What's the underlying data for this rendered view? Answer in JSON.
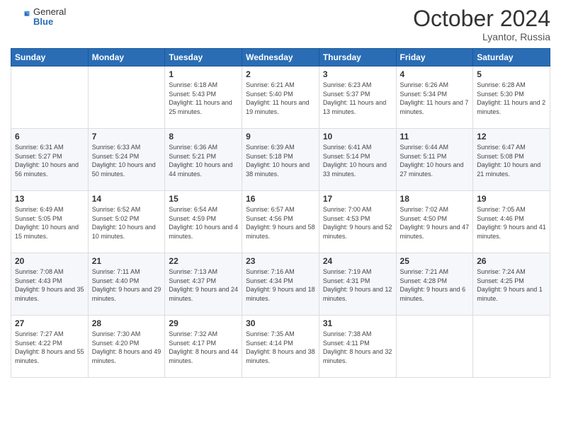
{
  "header": {
    "logo_general": "General",
    "logo_blue": "Blue",
    "month_title": "October 2024",
    "location": "Lyantor, Russia"
  },
  "weekdays": [
    "Sunday",
    "Monday",
    "Tuesday",
    "Wednesday",
    "Thursday",
    "Friday",
    "Saturday"
  ],
  "weeks": [
    [
      {
        "day": "",
        "info": ""
      },
      {
        "day": "",
        "info": ""
      },
      {
        "day": "1",
        "info": "Sunrise: 6:18 AM\nSunset: 5:43 PM\nDaylight: 11 hours and 25 minutes."
      },
      {
        "day": "2",
        "info": "Sunrise: 6:21 AM\nSunset: 5:40 PM\nDaylight: 11 hours and 19 minutes."
      },
      {
        "day": "3",
        "info": "Sunrise: 6:23 AM\nSunset: 5:37 PM\nDaylight: 11 hours and 13 minutes."
      },
      {
        "day": "4",
        "info": "Sunrise: 6:26 AM\nSunset: 5:34 PM\nDaylight: 11 hours and 7 minutes."
      },
      {
        "day": "5",
        "info": "Sunrise: 6:28 AM\nSunset: 5:30 PM\nDaylight: 11 hours and 2 minutes."
      }
    ],
    [
      {
        "day": "6",
        "info": "Sunrise: 6:31 AM\nSunset: 5:27 PM\nDaylight: 10 hours and 56 minutes."
      },
      {
        "day": "7",
        "info": "Sunrise: 6:33 AM\nSunset: 5:24 PM\nDaylight: 10 hours and 50 minutes."
      },
      {
        "day": "8",
        "info": "Sunrise: 6:36 AM\nSunset: 5:21 PM\nDaylight: 10 hours and 44 minutes."
      },
      {
        "day": "9",
        "info": "Sunrise: 6:39 AM\nSunset: 5:18 PM\nDaylight: 10 hours and 38 minutes."
      },
      {
        "day": "10",
        "info": "Sunrise: 6:41 AM\nSunset: 5:14 PM\nDaylight: 10 hours and 33 minutes."
      },
      {
        "day": "11",
        "info": "Sunrise: 6:44 AM\nSunset: 5:11 PM\nDaylight: 10 hours and 27 minutes."
      },
      {
        "day": "12",
        "info": "Sunrise: 6:47 AM\nSunset: 5:08 PM\nDaylight: 10 hours and 21 minutes."
      }
    ],
    [
      {
        "day": "13",
        "info": "Sunrise: 6:49 AM\nSunset: 5:05 PM\nDaylight: 10 hours and 15 minutes."
      },
      {
        "day": "14",
        "info": "Sunrise: 6:52 AM\nSunset: 5:02 PM\nDaylight: 10 hours and 10 minutes."
      },
      {
        "day": "15",
        "info": "Sunrise: 6:54 AM\nSunset: 4:59 PM\nDaylight: 10 hours and 4 minutes."
      },
      {
        "day": "16",
        "info": "Sunrise: 6:57 AM\nSunset: 4:56 PM\nDaylight: 9 hours and 58 minutes."
      },
      {
        "day": "17",
        "info": "Sunrise: 7:00 AM\nSunset: 4:53 PM\nDaylight: 9 hours and 52 minutes."
      },
      {
        "day": "18",
        "info": "Sunrise: 7:02 AM\nSunset: 4:50 PM\nDaylight: 9 hours and 47 minutes."
      },
      {
        "day": "19",
        "info": "Sunrise: 7:05 AM\nSunset: 4:46 PM\nDaylight: 9 hours and 41 minutes."
      }
    ],
    [
      {
        "day": "20",
        "info": "Sunrise: 7:08 AM\nSunset: 4:43 PM\nDaylight: 9 hours and 35 minutes."
      },
      {
        "day": "21",
        "info": "Sunrise: 7:11 AM\nSunset: 4:40 PM\nDaylight: 9 hours and 29 minutes."
      },
      {
        "day": "22",
        "info": "Sunrise: 7:13 AM\nSunset: 4:37 PM\nDaylight: 9 hours and 24 minutes."
      },
      {
        "day": "23",
        "info": "Sunrise: 7:16 AM\nSunset: 4:34 PM\nDaylight: 9 hours and 18 minutes."
      },
      {
        "day": "24",
        "info": "Sunrise: 7:19 AM\nSunset: 4:31 PM\nDaylight: 9 hours and 12 minutes."
      },
      {
        "day": "25",
        "info": "Sunrise: 7:21 AM\nSunset: 4:28 PM\nDaylight: 9 hours and 6 minutes."
      },
      {
        "day": "26",
        "info": "Sunrise: 7:24 AM\nSunset: 4:25 PM\nDaylight: 9 hours and 1 minute."
      }
    ],
    [
      {
        "day": "27",
        "info": "Sunrise: 7:27 AM\nSunset: 4:22 PM\nDaylight: 8 hours and 55 minutes."
      },
      {
        "day": "28",
        "info": "Sunrise: 7:30 AM\nSunset: 4:20 PM\nDaylight: 8 hours and 49 minutes."
      },
      {
        "day": "29",
        "info": "Sunrise: 7:32 AM\nSunset: 4:17 PM\nDaylight: 8 hours and 44 minutes."
      },
      {
        "day": "30",
        "info": "Sunrise: 7:35 AM\nSunset: 4:14 PM\nDaylight: 8 hours and 38 minutes."
      },
      {
        "day": "31",
        "info": "Sunrise: 7:38 AM\nSunset: 4:11 PM\nDaylight: 8 hours and 32 minutes."
      },
      {
        "day": "",
        "info": ""
      },
      {
        "day": "",
        "info": ""
      }
    ]
  ]
}
